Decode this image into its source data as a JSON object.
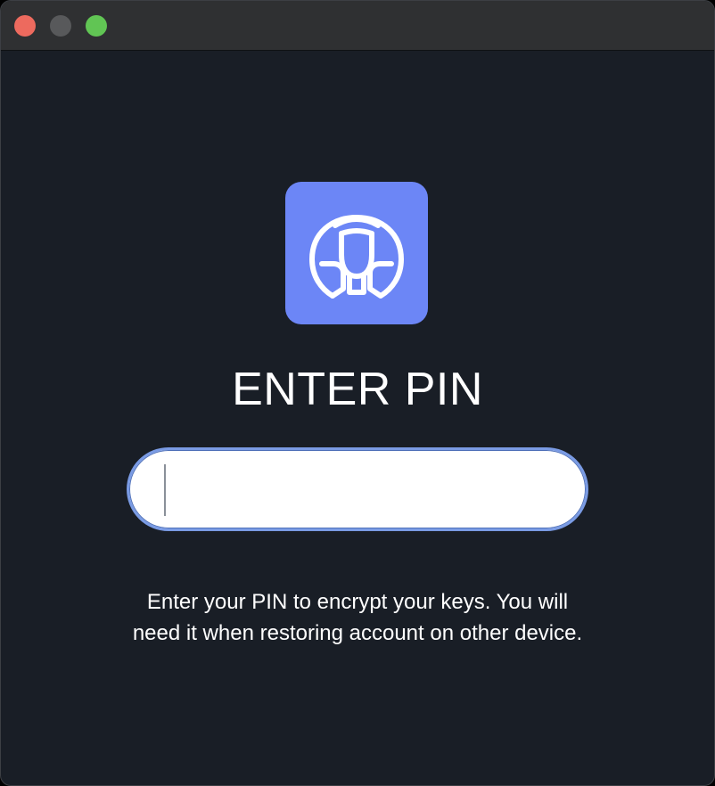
{
  "window": {
    "controls": {
      "close_color": "#ED6A5E",
      "minimize_color": "#58595B",
      "maximize_color": "#61C554"
    }
  },
  "app": {
    "icon": "pharaoh-sphinx-icon",
    "icon_bg": "#6C86F6",
    "icon_stroke": "#FFFFFF"
  },
  "pin": {
    "title": "ENTER PIN",
    "value": "",
    "placeholder": "",
    "field_border": "#7A9BE4",
    "hint": "Enter your PIN to encrypt your keys. You will need it when restoring account on other device."
  }
}
